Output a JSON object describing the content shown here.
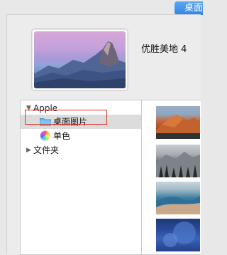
{
  "window": {
    "top_tab_label": "桌面"
  },
  "current_wallpaper": {
    "name": "优胜美地 4"
  },
  "sidebar": {
    "group_label": "Apple",
    "items": [
      {
        "label": "桌面图片",
        "icon": "folder-icon",
        "selected": true
      },
      {
        "label": "单色",
        "icon": "color-wheel-icon",
        "selected": false
      }
    ],
    "folders_label": "文件夹"
  },
  "thumbnails": [
    {
      "name": "el-capitan-wallpaper"
    },
    {
      "name": "misty-forest-wallpaper"
    },
    {
      "name": "ocean-wave-wallpaper"
    },
    {
      "name": "blue-abstract-wallpaper"
    }
  ],
  "colors": {
    "accent": "#2f83e6",
    "highlight_box": "#e0332b",
    "selected_row": "#dcdcdc"
  }
}
